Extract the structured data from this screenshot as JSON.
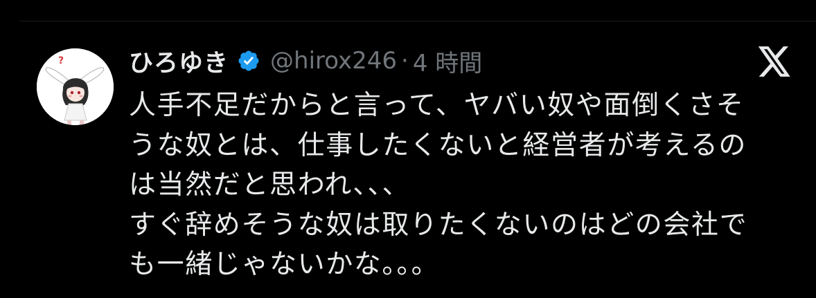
{
  "tweet": {
    "author": {
      "display_name": "ひろゆき",
      "handle": "@hirox246",
      "verified": true
    },
    "separator": "·",
    "time": "4 時間",
    "text": "人手不足だからと言って、ヤバい奴や面倒くさそ\nうな奴とは、仕事したくないと経営者が考えるの\nは当然だと思われ、、、\nすぐ辞めそうな奴は取りたくないのはどの会社で\nも一緒じゃないかな。。。",
    "icons": {
      "verified": "verified-badge-icon",
      "platform": "x-logo-icon"
    },
    "colors": {
      "background": "#000000",
      "primary_text": "#e7e9ea",
      "secondary_text": "#71767b",
      "verified_blue": "#1d9bf0"
    }
  }
}
